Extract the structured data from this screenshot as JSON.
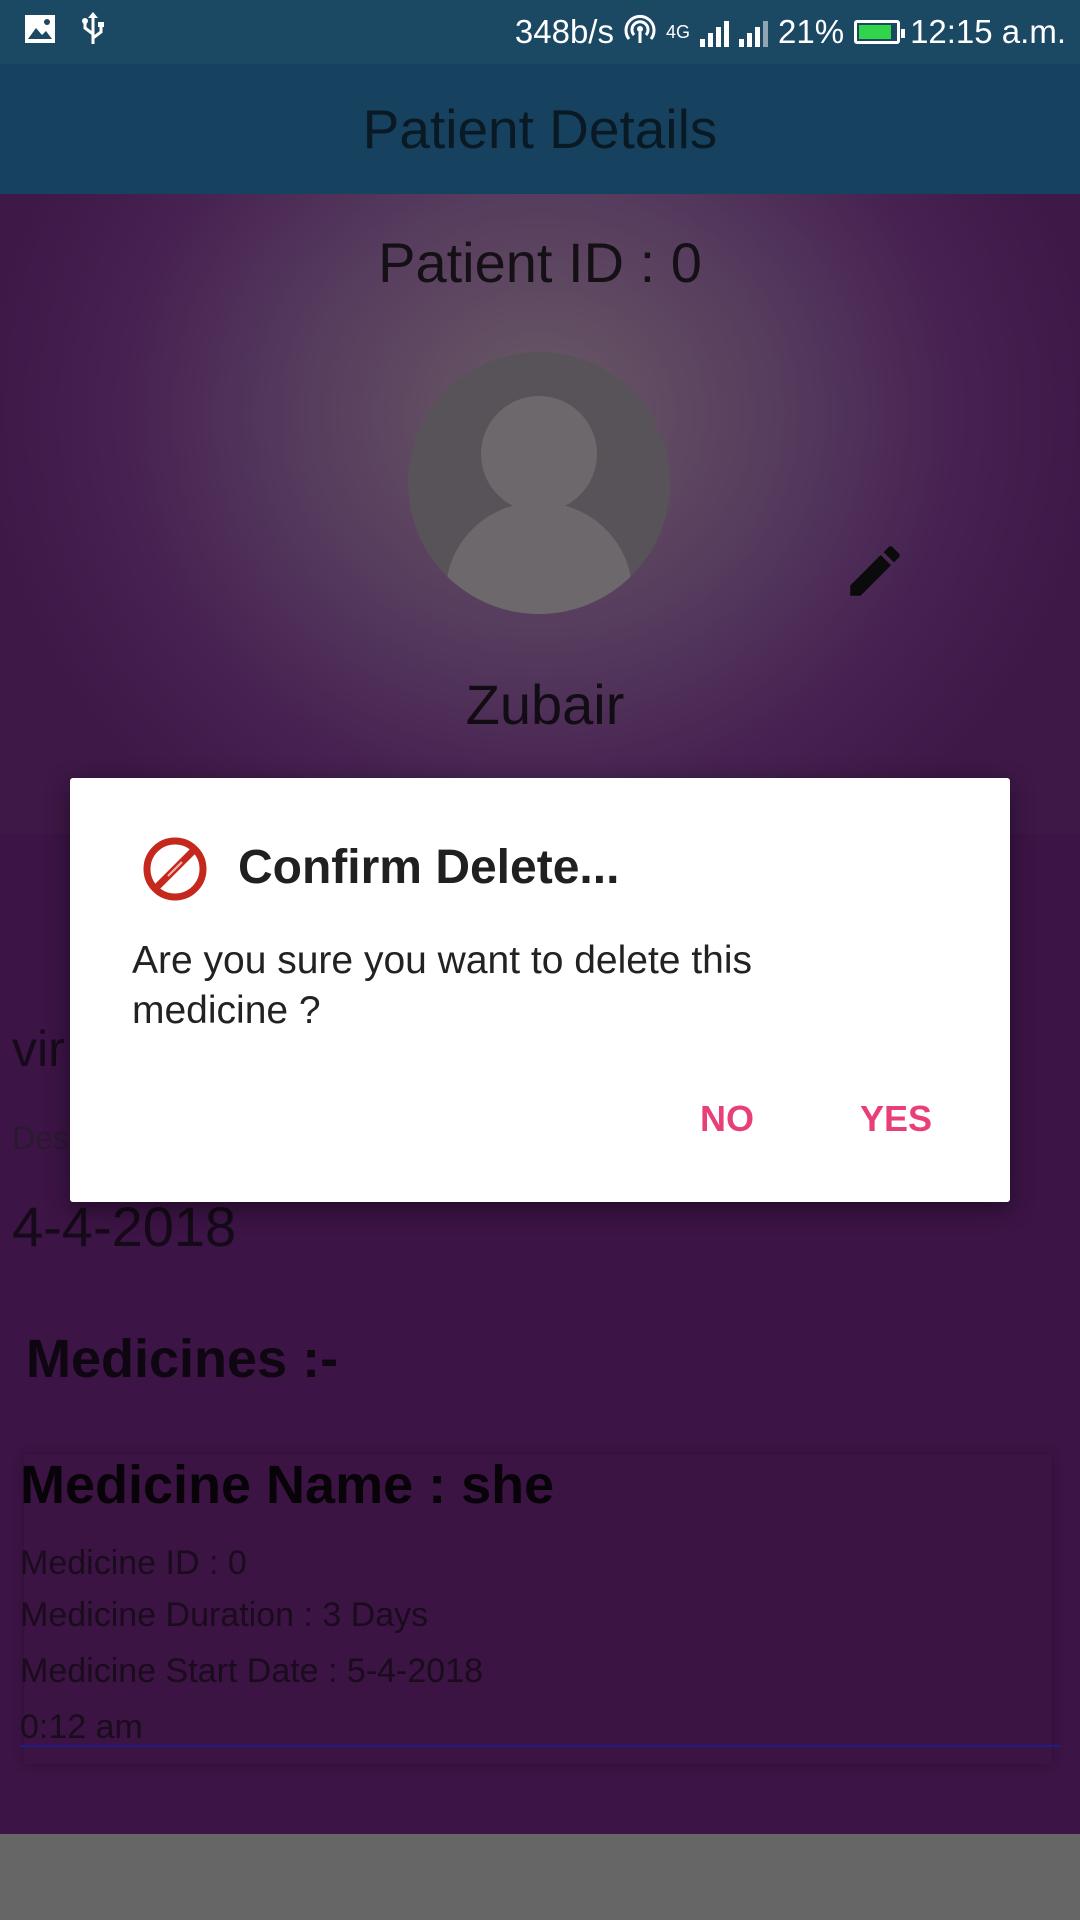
{
  "status_bar": {
    "net_speed": "348b/s",
    "network_type": "4G",
    "battery_percent": "21%",
    "battery_level": 0.21,
    "time": "12:15 a.m.",
    "icons": [
      "image-icon",
      "usb-icon",
      "hotspot-icon",
      "signal-icon",
      "signal-icon",
      "battery-icon"
    ]
  },
  "app_bar": {
    "title": "Patient Details"
  },
  "patient": {
    "id_label": "Patient ID : 0",
    "name": "Zubair",
    "partial_text_1": "vir",
    "partial_text_2": "Des",
    "date": "4-4-2018"
  },
  "medicines": {
    "heading": "Medicines :-",
    "items": [
      {
        "name": "Medicine Name : she",
        "id": "Medicine ID : 0",
        "duration": "Medicine Duration : 3 Days",
        "start_date": "Medicine Start Date : 5-4-2018",
        "time": "0:12 am"
      }
    ]
  },
  "dialog": {
    "icon": "no-entry-icon",
    "title": "Confirm Delete...",
    "message": "Are you sure you want to delete this medicine ?",
    "no_label": "NO",
    "yes_label": "YES"
  },
  "colors": {
    "status_bar": "#1b4863",
    "app_bar": "#164260",
    "content_background": "#3c1445",
    "dialog_button": "#e93f79",
    "battery": "#31d54a"
  }
}
